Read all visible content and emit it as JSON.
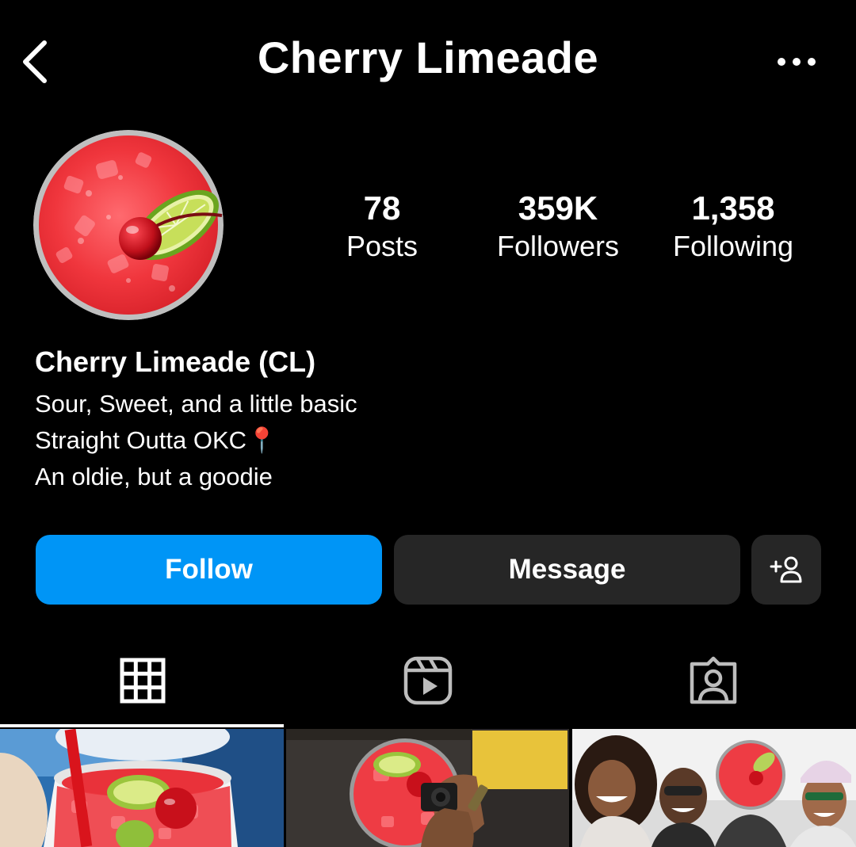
{
  "header": {
    "title": "Cherry Limeade",
    "back_icon": "chevron-left-icon",
    "more_icon": "more-horizontal-icon"
  },
  "profile": {
    "stats": [
      {
        "value": "78",
        "label": "Posts"
      },
      {
        "value": "359K",
        "label": "Followers"
      },
      {
        "value": "1,358",
        "label": "Following"
      }
    ],
    "display_name": "Cherry Limeade (CL)",
    "bio_lines": [
      "Sour, Sweet, and a little basic",
      "Straight Outta OKC📍",
      "An oldie, but a goodie"
    ]
  },
  "actions": {
    "follow_label": "Follow",
    "message_label": "Message",
    "add_user_icon": "add-user-icon"
  },
  "tabs": [
    {
      "name": "posts",
      "icon": "grid-icon",
      "active": true
    },
    {
      "name": "reels",
      "icon": "reels-icon",
      "active": false
    },
    {
      "name": "tagged",
      "icon": "tagged-person-icon",
      "active": false
    }
  ],
  "colors": {
    "background": "#000000",
    "follow_button": "#0095f6",
    "secondary_button": "#262626",
    "text": "#ffffff"
  }
}
